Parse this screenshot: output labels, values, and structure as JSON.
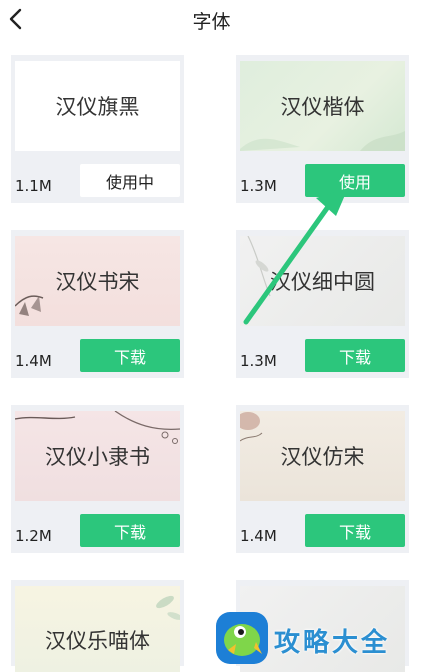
{
  "header": {
    "title": "字体",
    "back_icon": "chevron-left-icon"
  },
  "fonts": [
    {
      "name": "汉仪旗黑",
      "size": "1.1M",
      "action": "使用中",
      "state": "in-use"
    },
    {
      "name": "汉仪楷体",
      "size": "1.3M",
      "action": "使用",
      "state": "use"
    },
    {
      "name": "汉仪书宋",
      "size": "1.4M",
      "action": "下载",
      "state": "download"
    },
    {
      "name": "汉仪细中圆",
      "size": "1.3M",
      "action": "下载",
      "state": "download"
    },
    {
      "name": "汉仪小隶书",
      "size": "1.2M",
      "action": "下载",
      "state": "download"
    },
    {
      "name": "汉仪仿宋",
      "size": "1.4M",
      "action": "下载",
      "state": "download"
    },
    {
      "name": "汉仪乐喵体",
      "size": "",
      "action": "",
      "state": "partial"
    },
    {
      "name": "",
      "size": "",
      "action": "",
      "state": "partial"
    }
  ],
  "watermark": {
    "text": "攻略大全"
  },
  "colors": {
    "accent": "#2cc67c",
    "card_bg": "#eef0f4",
    "watermark": "#2b8fd1"
  }
}
